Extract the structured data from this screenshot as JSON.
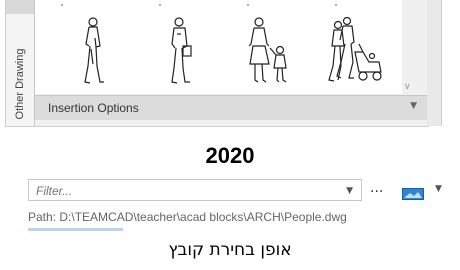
{
  "palette": {
    "side_tab_label": "Other Drawing",
    "insertion_label": "Insertion Options",
    "figures": [
      {
        "icon": "man-walking-icon"
      },
      {
        "icon": "man-with-bag-icon"
      },
      {
        "icon": "woman-with-child-icon"
      },
      {
        "icon": "couple-with-stroller-icon"
      }
    ]
  },
  "year_heading": "2020",
  "filter": {
    "placeholder": "Filter...",
    "ellipsis": "...",
    "path_text": "Path: D:\\TEAMCAD\\teacher\\acad blocks\\ARCH\\People.dwg"
  },
  "caption": "אופן בחירת קובץ"
}
